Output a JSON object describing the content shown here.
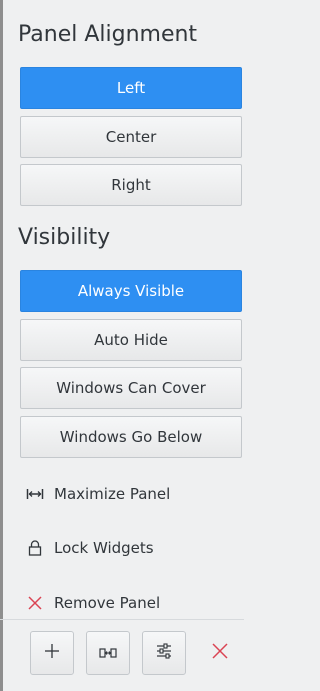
{
  "panel_alignment": {
    "title": "Panel Alignment",
    "options": [
      {
        "label": "Left",
        "selected": true
      },
      {
        "label": "Center",
        "selected": false
      },
      {
        "label": "Right",
        "selected": false
      }
    ]
  },
  "visibility": {
    "title": "Visibility",
    "options": [
      {
        "label": "Always Visible",
        "selected": true
      },
      {
        "label": "Auto Hide",
        "selected": false
      },
      {
        "label": "Windows Can Cover",
        "selected": false
      },
      {
        "label": "Windows Go Below",
        "selected": false
      }
    ]
  },
  "actions": [
    {
      "label": "Maximize Panel",
      "icon": "maximize-icon"
    },
    {
      "label": "Lock Widgets",
      "icon": "lock-icon"
    },
    {
      "label": "Remove Panel",
      "icon": "remove-icon"
    }
  ],
  "toolbar": {
    "add_icon": "plus-icon",
    "spacer_icon": "spacer-icon",
    "settings_icon": "settings-icon",
    "close_icon": "close-icon"
  },
  "colors": {
    "accent": "#2e8ff2",
    "danger": "#da4453",
    "background": "#eff0f1"
  }
}
